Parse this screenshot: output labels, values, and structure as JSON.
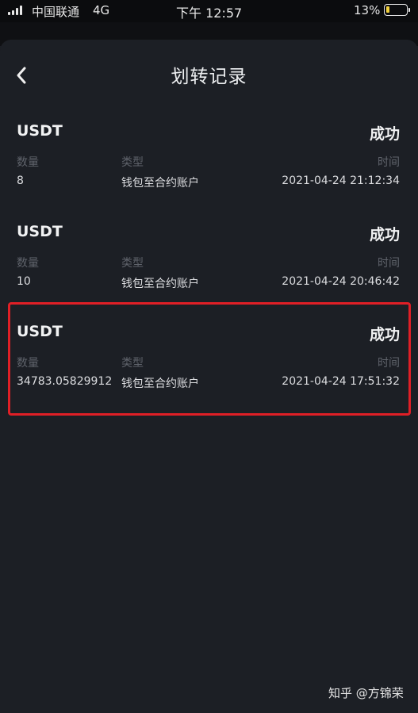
{
  "status_bar": {
    "carrier": "中国联通",
    "network": "4G",
    "time": "下午 12:57",
    "battery": "13%"
  },
  "header": {
    "title": "划转记录"
  },
  "records": [
    {
      "coin": "USDT",
      "status": "成功",
      "amount_label": "数量",
      "type_label": "类型",
      "time_label": "时间",
      "amount": "8",
      "type": "钱包至合约账户",
      "time": "2021-04-24 21:12:34"
    },
    {
      "coin": "USDT",
      "status": "成功",
      "amount_label": "数量",
      "type_label": "类型",
      "time_label": "时间",
      "amount": "10",
      "type": "钱包至合约账户",
      "time": "2021-04-24 20:46:42"
    },
    {
      "coin": "USDT",
      "status": "成功",
      "amount_label": "数量",
      "type_label": "类型",
      "time_label": "时间",
      "amount": "34783.05829912",
      "type": "钱包至合约账户",
      "time": "2021-04-24 17:51:32"
    }
  ],
  "watermark": "知乎 @方锦荣",
  "colors": {
    "background": "#1c1f25",
    "highlight": "#e01f26",
    "battery_low": "#f2d03c"
  }
}
